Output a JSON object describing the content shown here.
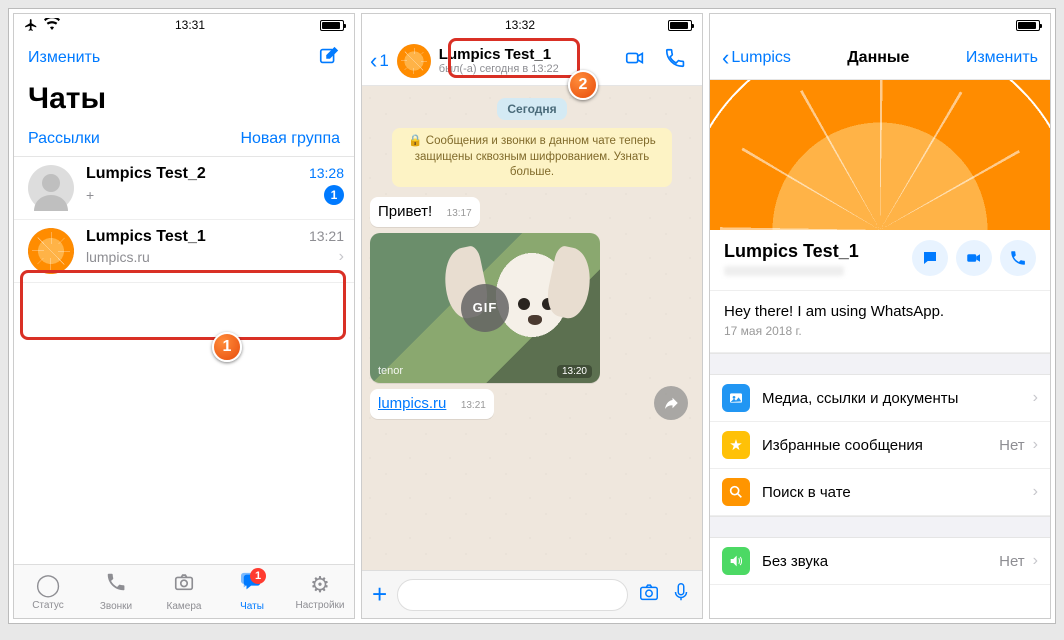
{
  "screen1": {
    "status": {
      "time": "13:31"
    },
    "nav": {
      "edit": "Изменить"
    },
    "title": "Чаты",
    "links": {
      "broadcasts": "Рассылки",
      "newgroup": "Новая группа"
    },
    "chats": [
      {
        "name": "Lumpics Test_2",
        "preview": "+",
        "time": "13:28",
        "badge": "1"
      },
      {
        "name": "Lumpics Test_1",
        "preview": "lumpics.ru",
        "time": "13:21"
      }
    ],
    "tabs": {
      "status": "Статус",
      "calls": "Звонки",
      "camera": "Камера",
      "chats": "Чаты",
      "settings": "Настройки",
      "chats_badge": "1"
    }
  },
  "screen2": {
    "status": {
      "time": "13:32"
    },
    "back_count": "1",
    "contact": {
      "name": "Lumpics Test_1",
      "status": "был(-а) сегодня в 13:22"
    },
    "date_pill": "Сегодня",
    "encryption": "🔒 Сообщения и звонки в данном чате теперь защищены сквозным шифрованием. Узнать больше.",
    "messages": {
      "m1": {
        "text": "Привет!",
        "time": "13:17"
      },
      "gif": {
        "label": "GIF",
        "source": "tenor",
        "time": "13:20"
      },
      "m2": {
        "text": "lumpics.ru",
        "time": "13:21"
      }
    }
  },
  "screen3": {
    "nav": {
      "back": "Lumpics",
      "title": "Данные",
      "edit": "Изменить"
    },
    "contact": {
      "name": "Lumpics Test_1"
    },
    "status": {
      "text": "Hey there! I am using WhatsApp.",
      "date": "17 мая 2018 г."
    },
    "rows": {
      "media": "Медиа, ссылки и документы",
      "starred": "Избранные сообщения",
      "starred_val": "Нет",
      "search": "Поиск в чате",
      "mute": "Без звука",
      "mute_val": "Нет"
    }
  },
  "annotations": {
    "a1": "1",
    "a2": "2"
  }
}
